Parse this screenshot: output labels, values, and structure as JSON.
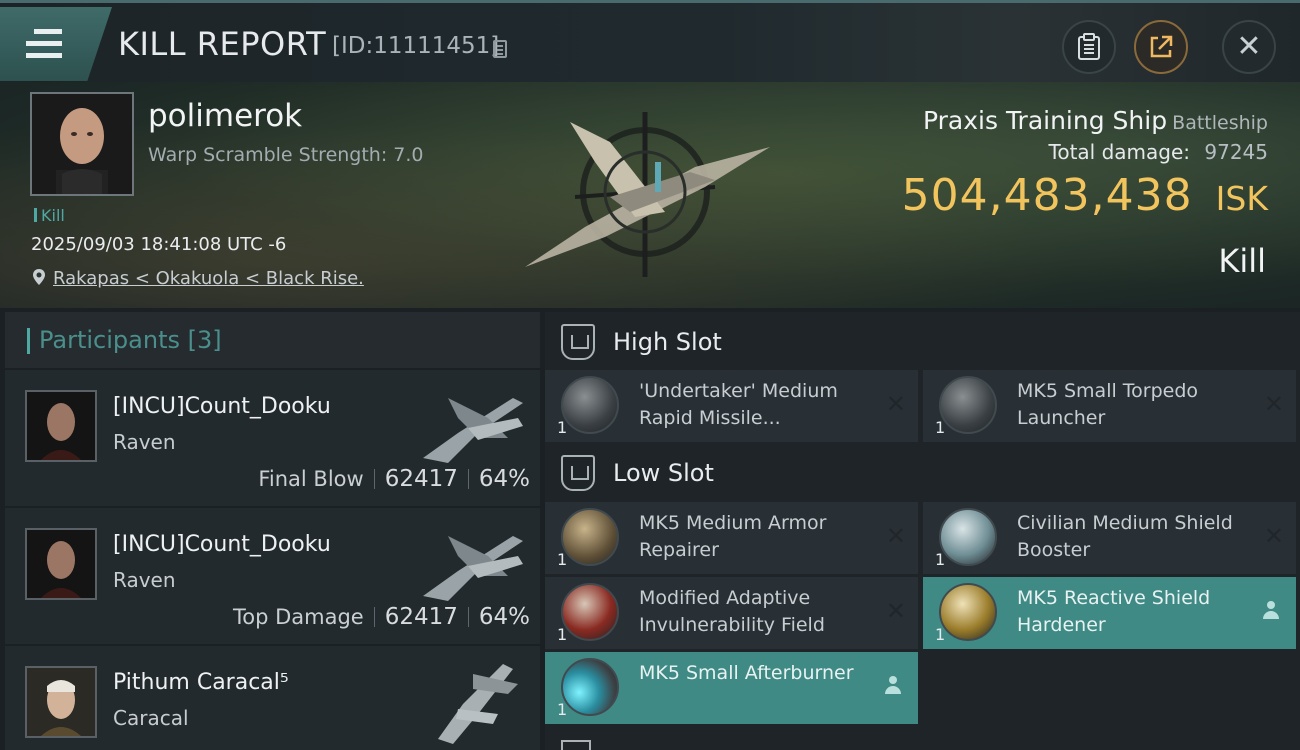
{
  "header": {
    "title": "KILL REPORT",
    "report_id": "[ID:11111451]",
    "icons": [
      "menu-icon",
      "copy-icon",
      "clipboard-icon",
      "share-icon",
      "close-icon"
    ],
    "close_glyph": "✕"
  },
  "victim": {
    "name": "polimerok",
    "warp_scramble": "Warp Scramble Strength: 7.0",
    "tag": "Kill",
    "datetime": "2025/09/03 18:41:08 UTC -6",
    "location": "Rakapas < Okakuola < Black Rise.",
    "ship_name": "Praxis Training Ship",
    "ship_class": "Battleship",
    "damage_label": "Total damage:",
    "damage_value": "97245",
    "isk_value": "504,483,438",
    "isk_unit": "ISK",
    "result": "Kill"
  },
  "participants": {
    "title": "Participants",
    "count": "[3]",
    "rows": [
      {
        "name": "[INCU]Count_Dooku",
        "ship": "Raven",
        "role": "Final Blow",
        "damage": "62417",
        "percent": "64%"
      },
      {
        "name": "[INCU]Count_Dooku",
        "ship": "Raven",
        "role": "Top Damage",
        "damage": "62417",
        "percent": "64%"
      },
      {
        "name": "Pithum Caracal⁵",
        "ship": "Caracal"
      }
    ]
  },
  "slots": {
    "high": {
      "title": "High Slot",
      "modules": [
        {
          "name": "'Undertaker' Medium Rapid Missile...",
          "qty": "1",
          "status": "destroyed"
        },
        {
          "name": "MK5 Small Torpedo Launcher",
          "qty": "1",
          "status": "destroyed"
        }
      ]
    },
    "low": {
      "title": "Low Slot",
      "modules": [
        {
          "name": "MK5 Medium Armor Repairer",
          "qty": "1",
          "status": "destroyed"
        },
        {
          "name": "Civilian Medium Shield Booster",
          "qty": "1",
          "status": "destroyed"
        },
        {
          "name": "Modified Adaptive Invulnerability Field",
          "qty": "1",
          "status": "destroyed"
        },
        {
          "name": "MK5 Reactive Shield Hardener",
          "qty": "1",
          "status": "dropped"
        },
        {
          "name": "MK5 Small Afterburner",
          "qty": "1",
          "status": "dropped"
        }
      ]
    },
    "x_glyph": "✕"
  },
  "colors": {
    "accent_teal": "#4fa9a3",
    "isk_gold": "#f1c45d",
    "dropped_bg": "#3f8a85",
    "destroyed_bg": "#283036"
  }
}
